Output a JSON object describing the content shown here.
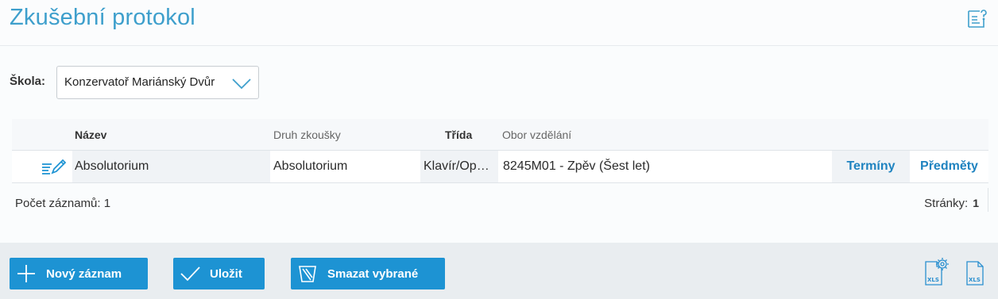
{
  "header": {
    "title": "Zkušební protokol"
  },
  "filter": {
    "label": "Škola:",
    "school": "Konzervatoř Mariánský Dvůr"
  },
  "grid": {
    "columns": {
      "name": "Název",
      "exam_type": "Druh zkoušky",
      "class": "Třída",
      "field": "Obor vzdělání"
    },
    "rows": [
      {
        "name": "Absolutorium",
        "exam_type": "Absolutorium",
        "class": "Klavír/Op…",
        "field": "8245M01 - Zpěv (Šest let)",
        "terms_link": "Termíny",
        "subjects_link": "Předměty"
      }
    ],
    "record_count": "Počet záznamů: 1",
    "pages_label": "Stránky:",
    "current_page": "1"
  },
  "toolbar": {
    "new_label": "Nový záznam",
    "save_label": "Uložit",
    "delete_label": "Smazat vybrané"
  },
  "export": {
    "xls_settings_text": "XLS",
    "xls_text": "XLS"
  },
  "colors": {
    "accent": "#1d93d3",
    "title": "#3e9fcc",
    "link": "#1f83c0",
    "toolbar_bg": "#e9edf0"
  }
}
